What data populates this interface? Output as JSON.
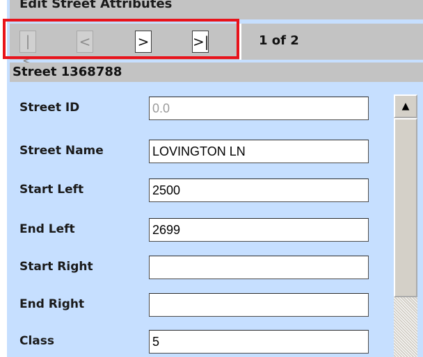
{
  "window": {
    "title": "Edit Street Attributes"
  },
  "nav": {
    "first_label": "|<",
    "prev_label": "<",
    "next_label": ">",
    "last_label": ">|",
    "record_count": "1 of 2"
  },
  "section": {
    "title": "Street 1368788"
  },
  "fields": [
    {
      "label": "Street ID",
      "value": "0.0",
      "readonly": true
    },
    {
      "label": "Street Name",
      "value": "LOVINGTON LN"
    },
    {
      "label": "Start Left",
      "value": "2500"
    },
    {
      "label": "End Left",
      "value": "2699"
    },
    {
      "label": "Start Right",
      "value": ""
    },
    {
      "label": "End Right",
      "value": ""
    },
    {
      "label": "Class",
      "value": "5"
    }
  ],
  "colors": {
    "panel_bg": "#c6dfff",
    "bar_bg": "#c3c3c3",
    "highlight": "#e8131b"
  },
  "icons": {
    "scroll_up": "triangle-up-icon"
  }
}
